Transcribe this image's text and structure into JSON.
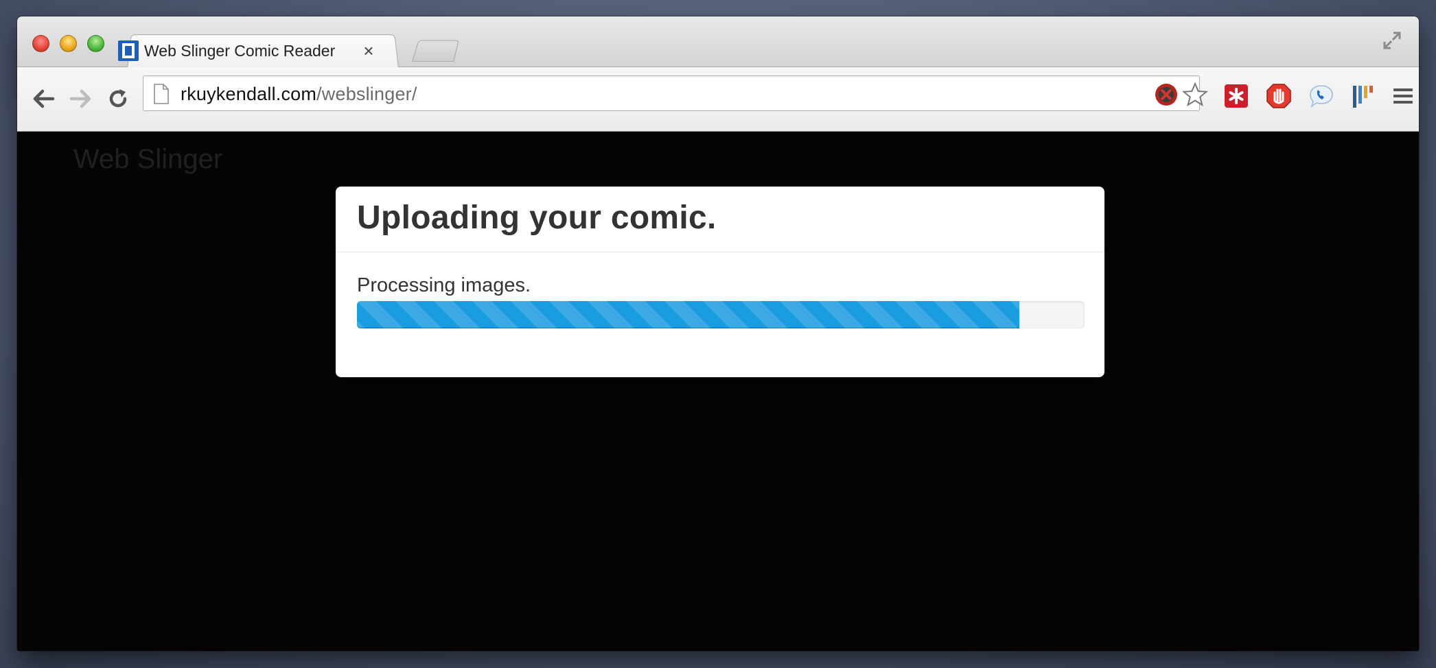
{
  "browser": {
    "tab": {
      "title": "Web Slinger Comic Reader",
      "close_glyph": "×",
      "favicon": "web-slinger-favicon"
    },
    "address_bar": {
      "domain": "rkuykendall.com",
      "path": "/webslinger/"
    },
    "extensions": [
      "adblock-disabled-icon",
      "bookmark-star-icon",
      "lastpass-icon",
      "adblock-plus-icon",
      "skype-icon",
      "pocket-bars-icon",
      "chrome-menu-icon"
    ]
  },
  "page": {
    "brand": "Web Slinger",
    "modal": {
      "title": "Uploading your comic.",
      "status": "Processing images.",
      "progress_fraction": 0.91
    }
  },
  "colors": {
    "progress": "#1a9ce0",
    "page_background": "#050505"
  }
}
